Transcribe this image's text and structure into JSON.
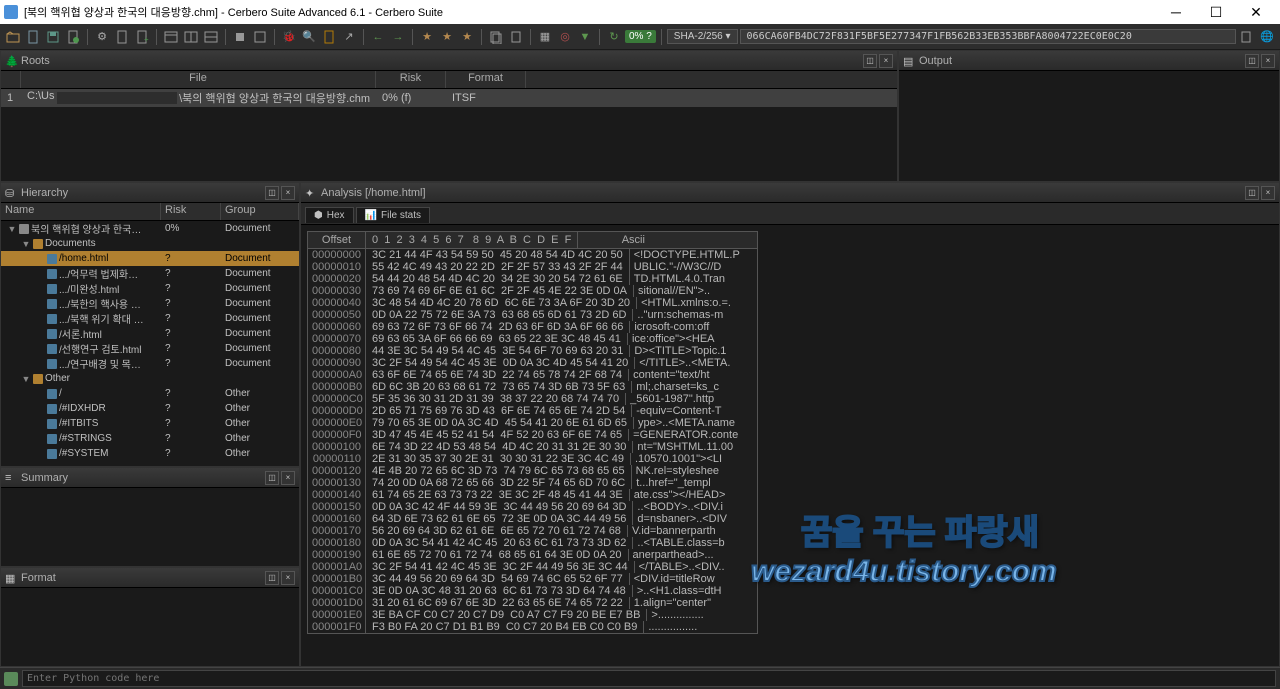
{
  "title": "[북의 핵위협 양상과 한국의 대응방향.chm] - Cerbero Suite Advanced 6.1 - Cerbero Suite",
  "toolbar": {
    "risk_badge": "0% ?",
    "hash_algo": "SHA-2/256",
    "hash_value": "066CA60FB4DC72F831F5BF5E277347F1FB562B33EB353BBFA8004722EC0E0C20"
  },
  "roots": {
    "title": "Roots",
    "columns": {
      "file": "File",
      "risk": "Risk",
      "format": "Format"
    },
    "rows": [
      {
        "idx": "1",
        "path_left": "C:\\Us",
        "path_right": "\\북의 핵위협 양상과 한국의 대응방향.chm",
        "risk": "0% (f)",
        "format": "ITSF"
      }
    ]
  },
  "output": {
    "title": "Output"
  },
  "hierarchy": {
    "title": "Hierarchy",
    "columns": {
      "name": "Name",
      "risk": "Risk",
      "group": "Group"
    },
    "rows": [
      {
        "indent": 0,
        "arrow": "▼",
        "icon": "root",
        "name": "북의 핵위협 양상과 한국…",
        "risk": "0%",
        "group": "Document",
        "sel": false
      },
      {
        "indent": 1,
        "arrow": "▼",
        "icon": "folder",
        "name": "Documents",
        "risk": "",
        "group": "",
        "sel": false
      },
      {
        "indent": 2,
        "arrow": "",
        "icon": "doc",
        "name": "/home.html",
        "risk": "?",
        "group": "Document",
        "sel": true
      },
      {
        "indent": 2,
        "arrow": "",
        "icon": "doc",
        "name": ".../억무력 법제화…",
        "risk": "?",
        "group": "Document",
        "sel": false
      },
      {
        "indent": 2,
        "arrow": "",
        "icon": "doc",
        "name": ".../미완성.html",
        "risk": "?",
        "group": "Document",
        "sel": false
      },
      {
        "indent": 2,
        "arrow": "",
        "icon": "doc",
        "name": ".../북한의 핵사용 …",
        "risk": "?",
        "group": "Document",
        "sel": false
      },
      {
        "indent": 2,
        "arrow": "",
        "icon": "doc",
        "name": ".../북핵 위기 확대 …",
        "risk": "?",
        "group": "Document",
        "sel": false
      },
      {
        "indent": 2,
        "arrow": "",
        "icon": "doc",
        "name": "/서론.html",
        "risk": "?",
        "group": "Document",
        "sel": false
      },
      {
        "indent": 2,
        "arrow": "",
        "icon": "doc",
        "name": "/선행연구 검토.html",
        "risk": "?",
        "group": "Document",
        "sel": false
      },
      {
        "indent": 2,
        "arrow": "",
        "icon": "doc",
        "name": ".../연구배경 및 목…",
        "risk": "?",
        "group": "Document",
        "sel": false
      },
      {
        "indent": 1,
        "arrow": "▼",
        "icon": "folder",
        "name": "Other",
        "risk": "",
        "group": "",
        "sel": false
      },
      {
        "indent": 2,
        "arrow": "",
        "icon": "doc",
        "name": "/",
        "risk": "?",
        "group": "Other",
        "sel": false
      },
      {
        "indent": 2,
        "arrow": "",
        "icon": "doc",
        "name": "/#IDXHDR",
        "risk": "?",
        "group": "Other",
        "sel": false
      },
      {
        "indent": 2,
        "arrow": "",
        "icon": "doc",
        "name": "/#ITBITS",
        "risk": "?",
        "group": "Other",
        "sel": false
      },
      {
        "indent": 2,
        "arrow": "",
        "icon": "doc",
        "name": "/#STRINGS",
        "risk": "?",
        "group": "Other",
        "sel": false
      },
      {
        "indent": 2,
        "arrow": "",
        "icon": "doc",
        "name": "/#SYSTEM",
        "risk": "?",
        "group": "Other",
        "sel": false
      }
    ]
  },
  "summary": {
    "title": "Summary"
  },
  "format": {
    "title": "Format"
  },
  "analysis": {
    "title": "Analysis [/home.html]",
    "tabs": [
      {
        "label": "Hex",
        "icon": "hex-icon",
        "active": true
      },
      {
        "label": "File stats",
        "icon": "stats-icon",
        "active": false
      }
    ],
    "hex_header": {
      "offset": "Offset",
      "bytes": "0  1  2  3  4  5  6  7   8  9  A  B  C  D  E  F",
      "ascii": "Ascii"
    },
    "hex_rows": [
      {
        "o": "00000000",
        "b": "3C 21 44 4F 43 54 59 50  45 20 48 54 4D 4C 20 50",
        "a": "<!DOCTYPE.HTML.P"
      },
      {
        "o": "00000010",
        "b": "55 42 4C 49 43 20 22 2D  2F 2F 57 33 43 2F 2F 44",
        "a": "UBLIC.\"-//W3C//D"
      },
      {
        "o": "00000020",
        "b": "54 44 20 48 54 4D 4C 20  34 2E 30 20 54 72 61 6E",
        "a": "TD.HTML.4.0.Tran"
      },
      {
        "o": "00000030",
        "b": "73 69 74 69 6F 6E 61 6C  2F 2F 45 4E 22 3E 0D 0A",
        "a": "sitional//EN\">.."
      },
      {
        "o": "00000040",
        "b": "3C 48 54 4D 4C 20 78 6D  6C 6E 73 3A 6F 20 3D 20",
        "a": "<HTML.xmlns:o.=."
      },
      {
        "o": "00000050",
        "b": "0D 0A 22 75 72 6E 3A 73  63 68 65 6D 61 73 2D 6D",
        "a": "..\"urn:schemas-m"
      },
      {
        "o": "00000060",
        "b": "69 63 72 6F 73 6F 66 74  2D 63 6F 6D 3A 6F 66 66",
        "a": "icrosoft-com:off"
      },
      {
        "o": "00000070",
        "b": "69 63 65 3A 6F 66 66 69  63 65 22 3E 3C 48 45 41",
        "a": "ice:office\"><HEA"
      },
      {
        "o": "00000080",
        "b": "44 3E 3C 54 49 54 4C 45  3E 54 6F 70 69 63 20 31",
        "a": "D><TITLE>Topic.1"
      },
      {
        "o": "00000090",
        "b": "3C 2F 54 49 54 4C 45 3E  0D 0A 3C 4D 45 54 41 20",
        "a": "</TITLE>..<META."
      },
      {
        "o": "000000A0",
        "b": "63 6F 6E 74 65 6E 74 3D  22 74 65 78 74 2F 68 74",
        "a": "content=\"text/ht"
      },
      {
        "o": "000000B0",
        "b": "6D 6C 3B 20 63 68 61 72  73 65 74 3D 6B 73 5F 63",
        "a": "ml;.charset=ks_c"
      },
      {
        "o": "000000C0",
        "b": "5F 35 36 30 31 2D 31 39  38 37 22 20 68 74 74 70",
        "a": "_5601-1987\".http"
      },
      {
        "o": "000000D0",
        "b": "2D 65 71 75 69 76 3D 43  6F 6E 74 65 6E 74 2D 54",
        "a": "-equiv=Content-T"
      },
      {
        "o": "000000E0",
        "b": "79 70 65 3E 0D 0A 3C 4D  45 54 41 20 6E 61 6D 65",
        "a": "ype>..<META.name"
      },
      {
        "o": "000000F0",
        "b": "3D 47 45 4E 45 52 41 54  4F 52 20 63 6F 6E 74 65",
        "a": "=GENERATOR.conte"
      },
      {
        "o": "00000100",
        "b": "6E 74 3D 22 4D 53 48 54  4D 4C 20 31 31 2E 30 30",
        "a": "nt=\"MSHTML.11.00"
      },
      {
        "o": "00000110",
        "b": "2E 31 30 35 37 30 2E 31  30 30 31 22 3E 3C 4C 49",
        "a": ".10570.1001\"><LI"
      },
      {
        "o": "00000120",
        "b": "4E 4B 20 72 65 6C 3D 73  74 79 6C 65 73 68 65 65",
        "a": "NK.rel=styleshee"
      },
      {
        "o": "00000130",
        "b": "74 20 0D 0A 68 72 65 66  3D 22 5F 74 65 6D 70 6C",
        "a": "t...href=\"_templ"
      },
      {
        "o": "00000140",
        "b": "61 74 65 2E 63 73 73 22  3E 3C 2F 48 45 41 44 3E",
        "a": "ate.css\"></HEAD>"
      },
      {
        "o": "00000150",
        "b": "0D 0A 3C 42 4F 44 59 3E  3C 44 49 56 20 69 64 3D",
        "a": "..<BODY>..<DIV.i"
      },
      {
        "o": "00000160",
        "b": "64 3D 6E 73 62 61 6E 65  72 3E 0D 0A 3C 44 49 56",
        "a": "d=nsbaner>..<DIV"
      },
      {
        "o": "00000170",
        "b": "56 20 69 64 3D 62 61 6E  6E 65 72 70 61 72 74 68",
        "a": "V.id=bannerparth"
      },
      {
        "o": "00000180",
        "b": "0D 0A 3C 54 41 42 4C 45  20 63 6C 61 73 73 3D 62",
        "a": "..<TABLE.class=b"
      },
      {
        "o": "00000190",
        "b": "61 6E 65 72 70 61 72 74  68 65 61 64 3E 0D 0A 20",
        "a": "anerparthead>..."
      },
      {
        "o": "000001A0",
        "b": "3C 2F 54 41 42 4C 45 3E  3C 2F 44 49 56 3E 3C 44",
        "a": "</TABLE>..<DIV.."
      },
      {
        "o": "000001B0",
        "b": "3C 44 49 56 20 69 64 3D  54 69 74 6C 65 52 6F 77",
        "a": "<DIV.id=titleRow"
      },
      {
        "o": "000001C0",
        "b": "3E 0D 0A 3C 48 31 20 63  6C 61 73 73 3D 64 74 48",
        "a": ">..<H1.class=dtH"
      },
      {
        "o": "000001D0",
        "b": "31 20 61 6C 69 67 6E 3D  22 63 65 6E 74 65 72 22",
        "a": "1.align=\"center\""
      },
      {
        "o": "000001E0",
        "b": "3E BA CF C0 C7 20 C7 D9  C0 A7 C7 F9 20 BE E7 BB",
        "a": ">..............."
      },
      {
        "o": "000001F0",
        "b": "F3 B0 FA 20 C7 D1 B1 B9  C0 C7 20 B4 EB C0 C0 B9",
        "a": "................"
      }
    ]
  },
  "watermarks": {
    "line1": "꿈을 꾸는 파랑새",
    "line2": "wezard4u.tistory.com"
  },
  "statusbar": {
    "placeholder": "Enter Python code here"
  }
}
